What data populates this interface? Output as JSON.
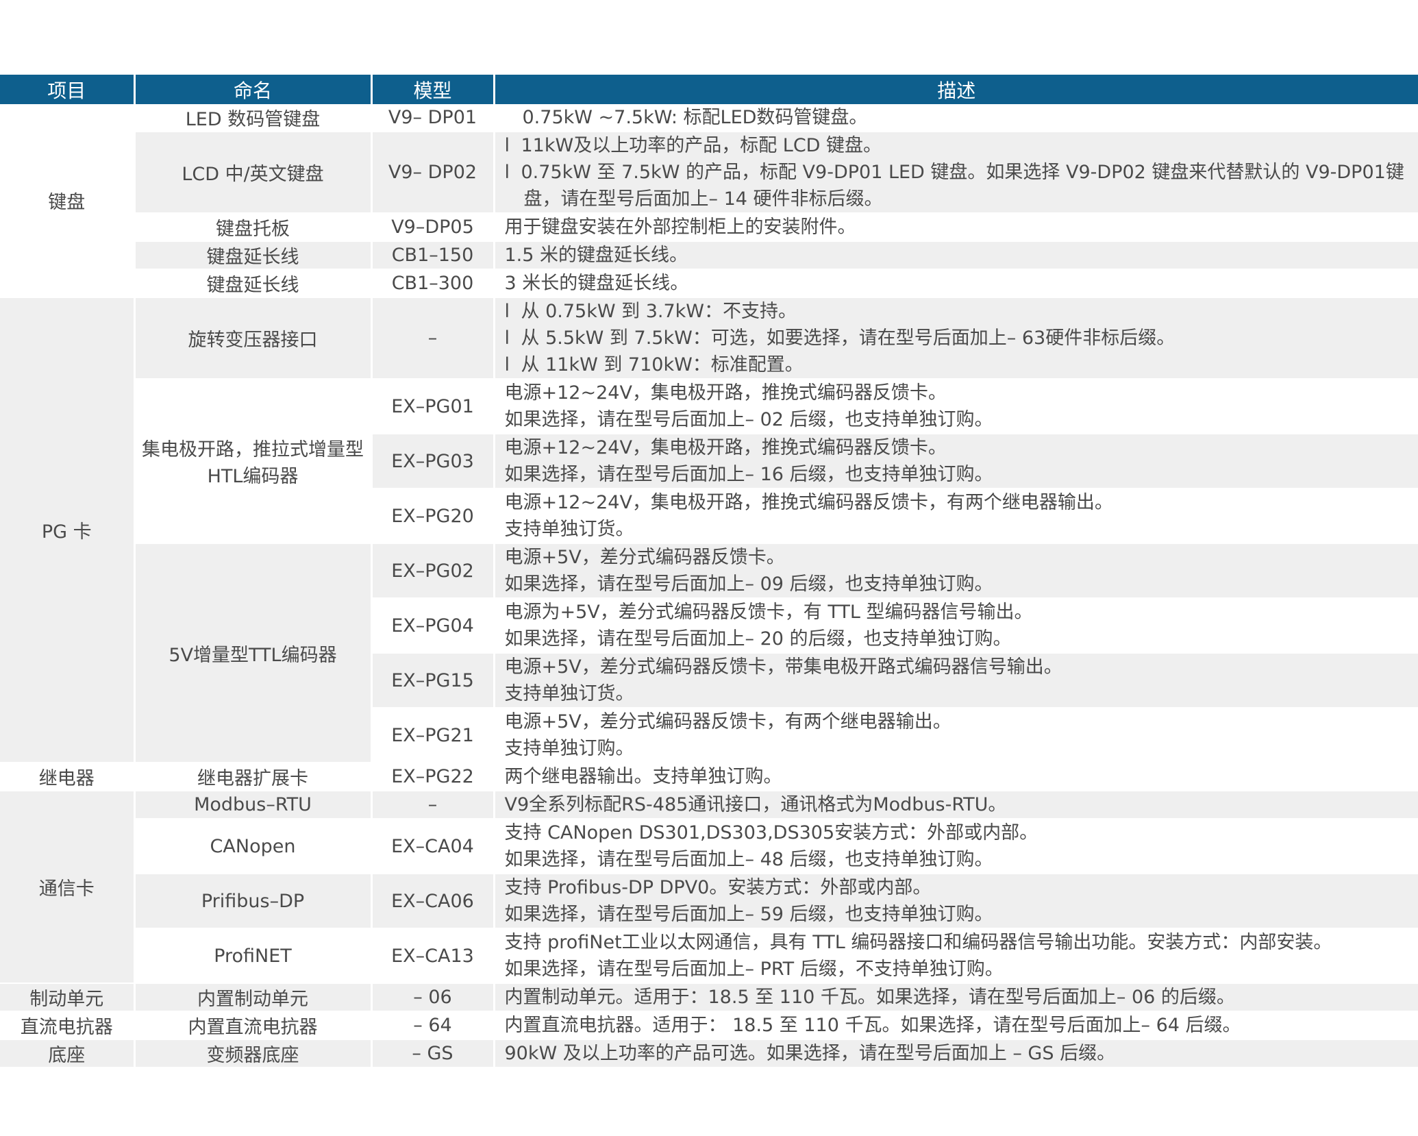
{
  "header": {
    "item": "项目",
    "name": "命名",
    "model": "模型",
    "desc": "描述"
  },
  "bullet": "l",
  "keyboard": {
    "category": "键盘",
    "r1": {
      "name": "LED 数码管键盘",
      "model": "V9– DP01",
      "desc": "0.75kW ~7.5kW: 标配LED数码管键盘。"
    },
    "r2": {
      "name": "LCD 中/英文键盘",
      "model": "V9– DP02",
      "d1": "11kW及以上功率的产品，标配 LCD 键盘。",
      "d2": "0.75kW 至 7.5kW 的产品，标配 V9-DP01 LED 键盘。如果选择 V9-DP02 键盘来代替默认的 V9-DP01键",
      "d3": "盘，请在型号后面加上– 14 硬件非标后缀。"
    },
    "r3": {
      "name": "键盘托板",
      "model": "V9–DP05",
      "desc": "用于键盘安装在外部控制柜上的安装附件。"
    },
    "r4": {
      "name": "键盘延长线",
      "model": "CB1–150",
      "desc": "1.5 米的键盘延长线。"
    },
    "r5": {
      "name": "键盘延长线",
      "model": "CB1–300",
      "desc": "3 米长的键盘延长线。"
    }
  },
  "pg": {
    "category": "PG 卡",
    "resolver": {
      "name": "旋转变压器接口",
      "model": "–",
      "d1": "从 0.75kW 到 3.7kW：不支持。",
      "d2": "从 5.5kW 到 7.5kW：可选，如要选择，请在型号后面加上– 63硬件非标后缀。",
      "d3": "从 11kW 到 710kW：标准配置。"
    },
    "htl_name_1": "集电极开路，推拉式增量型",
    "htl_name_2": "HTL编码器",
    "pg01": {
      "model": "EX–PG01",
      "d1": "电源+12~24V，集电极开路，推挽式编码器反馈卡。",
      "d2": "如果选择，请在型号后面加上– 02 后缀，也支持单独订购。"
    },
    "pg03": {
      "model": "EX–PG03",
      "d1": "电源+12~24V，集电极开路，推挽式编码器反馈卡。",
      "d2": "如果选择，请在型号后面加上– 16 后缀，也支持单独订购。"
    },
    "pg20": {
      "model": "EX–PG20",
      "d1": "电源+12~24V，集电极开路，推挽式编码器反馈卡，有两个继电器输出。",
      "d2": "支持单独订货。"
    },
    "ttl_name": "5V增量型TTL编码器",
    "pg02": {
      "model": "EX–PG02",
      "d1": "电源+5V，差分式编码器反馈卡。",
      "d2": "如果选择，请在型号后面加上– 09 后缀，也支持单独订购。"
    },
    "pg04": {
      "model": "EX–PG04",
      "d1": "电源为+5V，差分式编码器反馈卡，有 TTL 型编码器信号输出。",
      "d2": "如果选择，请在型号后面加上– 20 的后缀，也支持单独订购。"
    },
    "pg15": {
      "model": "EX–PG15",
      "d1": "电源+5V，差分式编码器反馈卡，带集电极开路式编码器信号输出。",
      "d2": "支持单独订货。"
    },
    "pg21": {
      "model": "EX–PG21",
      "d1": "电源+5V，差分式编码器反馈卡，有两个继电器输出。",
      "d2": "支持单独订购。"
    }
  },
  "relay": {
    "category": "继电器",
    "name": "继电器扩展卡",
    "model": "EX–PG22",
    "desc": "两个继电器输出。支持单独订购。"
  },
  "comm": {
    "category": "通信卡",
    "modbus": {
      "name": "Modbus–RTU",
      "model": "–",
      "desc": "V9全系列标配RS-485通讯接口，通讯格式为Modbus-RTU。"
    },
    "canopen": {
      "name": "CANopen",
      "model": "EX–CA04",
      "d1": "支持 CANopen DS301,DS303,DS305安装方式：外部或内部。",
      "d2": "如果选择，请在型号后面加上– 48 后缀，也支持单独订购。"
    },
    "profibus": {
      "name": "Prifibus–DP",
      "model": "EX–CA06",
      "d1": "支持 Profibus-DP DPV0。安装方式：外部或内部。",
      "d2": "如果选择，请在型号后面加上– 59 后缀，也支持单独订购。"
    },
    "profinet": {
      "name": "ProfiNET",
      "model": "EX–CA13",
      "d1": "支持 profiNet工业以太网通信，具有 TTL 编码器接口和编码器信号输出功能。安装方式：内部安装。",
      "d2": "如果选择，请在型号后面加上– PRT 后缀，不支持单独订购。"
    }
  },
  "brake": {
    "category": "制动单元",
    "name": "内置制动单元",
    "model": "– 06",
    "desc": "内置制动单元。适用于：18.5 至 110 千瓦。如果选择，请在型号后面加上– 06 的后缀。"
  },
  "dcr": {
    "category": "直流电抗器",
    "name": "内置直流电抗器",
    "model": "– 64",
    "desc": "内置直流电抗器。适用于： 18.5 至 110 千瓦。如果选择，请在型号后面加上– 64 后缀。"
  },
  "base": {
    "category": "底座",
    "name": "变频器底座",
    "model": "– GS",
    "desc": "90kW 及以上功率的产品可选。如果选择，请在型号后面加上 – GS 后缀。"
  }
}
